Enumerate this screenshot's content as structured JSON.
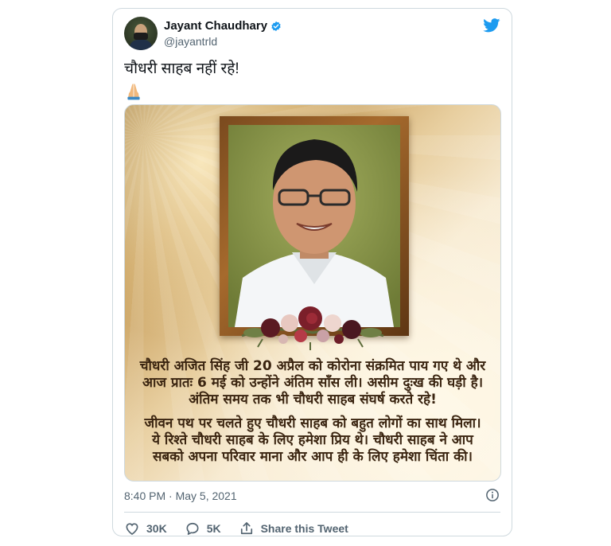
{
  "tweet": {
    "author_name": "Jayant Chaudhary",
    "author_handle": "@jayantrld",
    "text": "चौधरी साहब नहीं रहे!",
    "emoji": "🙏"
  },
  "media": {
    "lines_block1": [
      "चौधरी अजित सिंह जी 20 अप्रैल  को कोरोना संक्रमित पाय गए थे और",
      "आज प्रातः 6 मई को उन्होंने अंतिम साँस ली। असीम दुःख की घड़ी है।",
      "अंतिम समय तक भी चौधरी साहब संघर्ष करते रहे!"
    ],
    "lines_block2": [
      "जीवन पथ पर चलते हुए चौधरी साहब को बहुत लोगों का साथ मिला।",
      "ये रिश्ते चौधरी साहब के लिए हमेशा प्रिय थे। चौधरी साहब ने आप",
      "सबको अपना परिवार माना और आप ही के लिए हमेशा चिंता की।"
    ]
  },
  "meta": {
    "timestamp": "8:40 PM · May 5, 2021"
  },
  "actions": {
    "likes": "30K",
    "replies": "5K",
    "share_label": "Share this Tweet"
  },
  "colors": {
    "twitter_blue": "#1d9bf0",
    "text_primary": "#0f1419",
    "text_secondary": "#536471",
    "border": "#cfd9de"
  },
  "icons": [
    "verified-badge-icon",
    "twitter-bird-icon",
    "info-icon",
    "heart-icon",
    "reply-icon",
    "share-icon"
  ]
}
